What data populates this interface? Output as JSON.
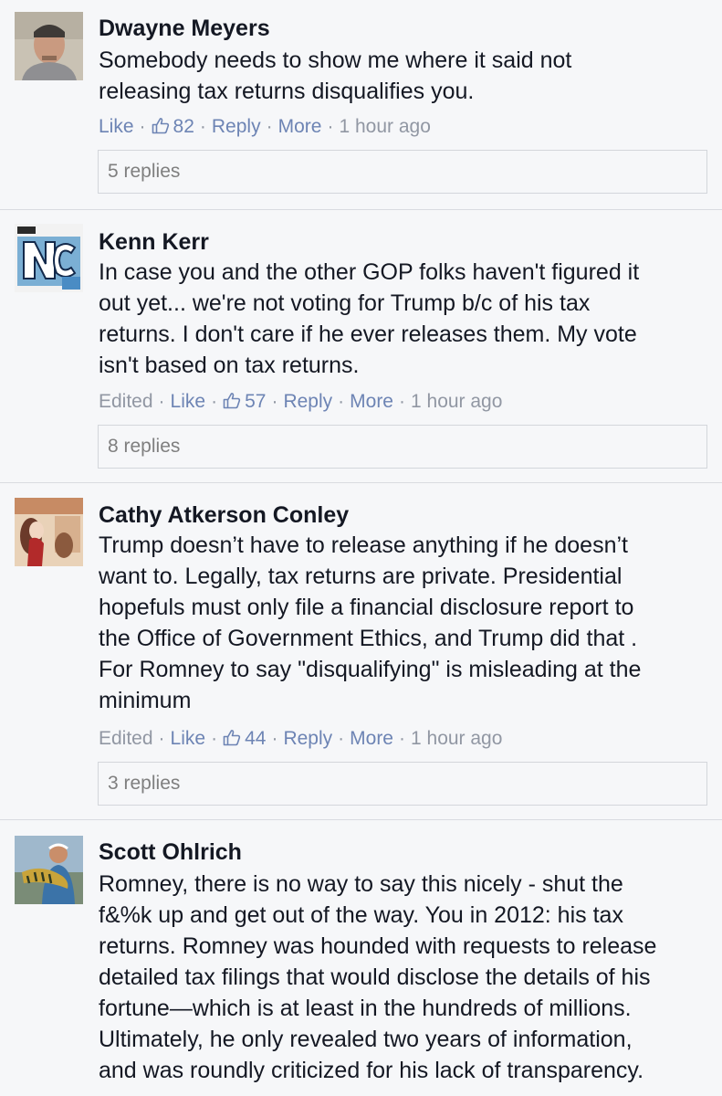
{
  "comments": [
    {
      "author": "Dwayne Meyers",
      "lines": [
        "Somebody needs to show me where it said not",
        "releasing tax returns disqualifies you."
      ],
      "edited": "",
      "like": "Like",
      "likes": "82",
      "reply": "Reply",
      "more": "More",
      "time": "1 hour ago",
      "replies": "5 replies"
    },
    {
      "author": "Kenn Kerr",
      "lines": [
        "In case you and the other GOP folks haven't figured it",
        "out yet... we're not voting for Trump b/c of his tax",
        "returns. I don't care if he ever releases them. My vote",
        "isn't based on tax returns."
      ],
      "edited": "Edited",
      "like": "Like",
      "likes": "57",
      "reply": "Reply",
      "more": "More",
      "time": "1 hour ago",
      "replies": "8 replies"
    },
    {
      "author": "Cathy Atkerson Conley",
      "lines": [
        "Trump doesn’t have to release anything if he doesn’t",
        "want to. Legally, tax returns are private. Presidential",
        "hopefuls must only file a financial disclosure report to",
        "the Office of Government Ethics, and Trump did that .",
        "For Romney to say \"disqualifying\" is misleading at the",
        "minimum"
      ],
      "edited": "Edited",
      "like": "Like",
      "likes": "44",
      "reply": "Reply",
      "more": "More",
      "time": "1 hour ago",
      "replies": "3 replies"
    },
    {
      "author": "Scott Ohlrich",
      "lines": [
        "Romney, there is no way to say this nicely - shut the",
        "f&%k up and get out of the way. You in 2012: his tax",
        "returns. Romney was hounded with requests to release",
        "detailed tax filings that would disclose the details of his",
        "fortune—which is at least in the hundreds of millions.",
        "Ultimately, he only revealed two years of information,",
        "and was roundly criticized for his lack of transparency."
      ]
    }
  ],
  "colors": {
    "link": "#6d84b4",
    "meta": "#9197a3",
    "text": "#141823",
    "background": "#f6f7f9"
  }
}
